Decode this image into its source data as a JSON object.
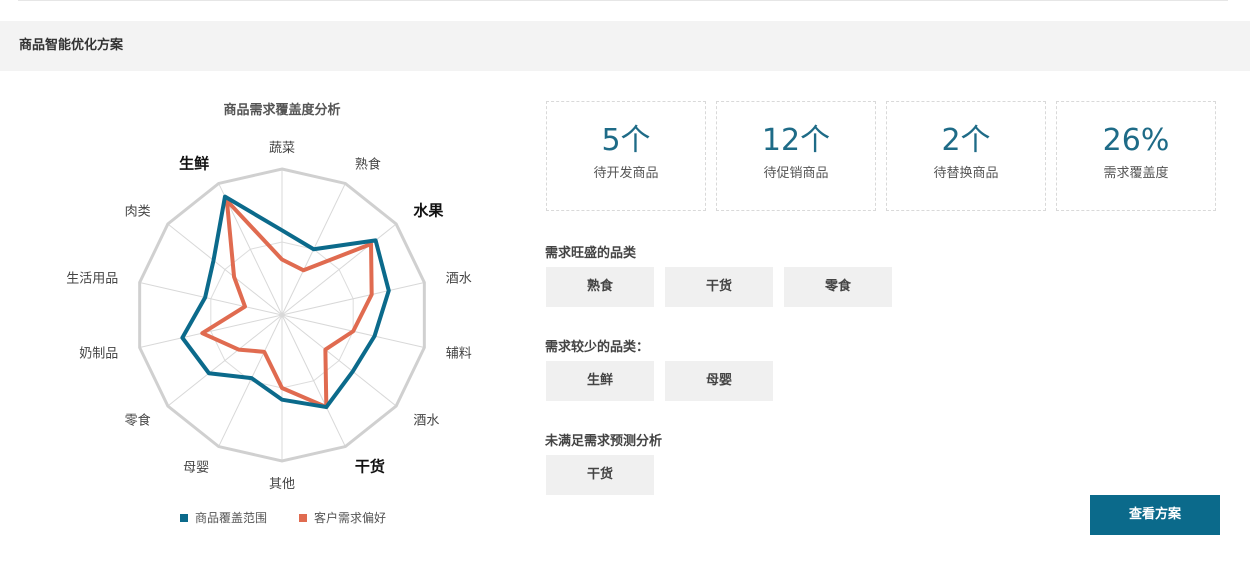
{
  "section": {
    "title": "商品智能优化方案"
  },
  "chart_data": {
    "type": "radar",
    "title": "商品需求覆盖度分析",
    "axes": [
      "蔬菜",
      "熟食",
      "水果",
      "酒水",
      "辅料",
      "酒水",
      "干货",
      "其他",
      "母婴",
      "零食",
      "奶制品",
      "生活用品",
      "肉类",
      "生鲜"
    ],
    "bold_axes": [
      "生鲜",
      "水果",
      "干货"
    ],
    "max": 10,
    "grid_levels": 2,
    "series": [
      {
        "name": "商品覆盖范围",
        "color": "#0b6a8b",
        "values": [
          5.8,
          5.0,
          8.2,
          7.5,
          6.5,
          6.2,
          7.0,
          5.8,
          4.8,
          6.4,
          7.0,
          5.4,
          6.0,
          9.0
        ]
      },
      {
        "name": "客户需求偏好",
        "color": "#e06b50",
        "values": [
          3.8,
          3.4,
          7.8,
          6.3,
          5.0,
          3.8,
          7.0,
          5.0,
          2.8,
          3.8,
          5.6,
          2.6,
          4.2,
          8.7
        ]
      }
    ]
  },
  "stats": [
    {
      "value": "5个",
      "label": "待开发商品"
    },
    {
      "value": "12个",
      "label": "待促销商品"
    },
    {
      "value": "2个",
      "label": "待替换商品"
    },
    {
      "value": "26%",
      "label": "需求覆盖度"
    }
  ],
  "groups": {
    "high_demand": {
      "title": "需求旺盛的品类",
      "tags": [
        "熟食",
        "干货",
        "零食"
      ]
    },
    "low_demand": {
      "title": "需求较少的品类：",
      "tags": [
        "生鲜",
        "母婴"
      ]
    },
    "unmet": {
      "title": "未满足需求预测分析",
      "tags": [
        "干货"
      ]
    }
  },
  "actions": {
    "view_plan": "查看方案"
  }
}
